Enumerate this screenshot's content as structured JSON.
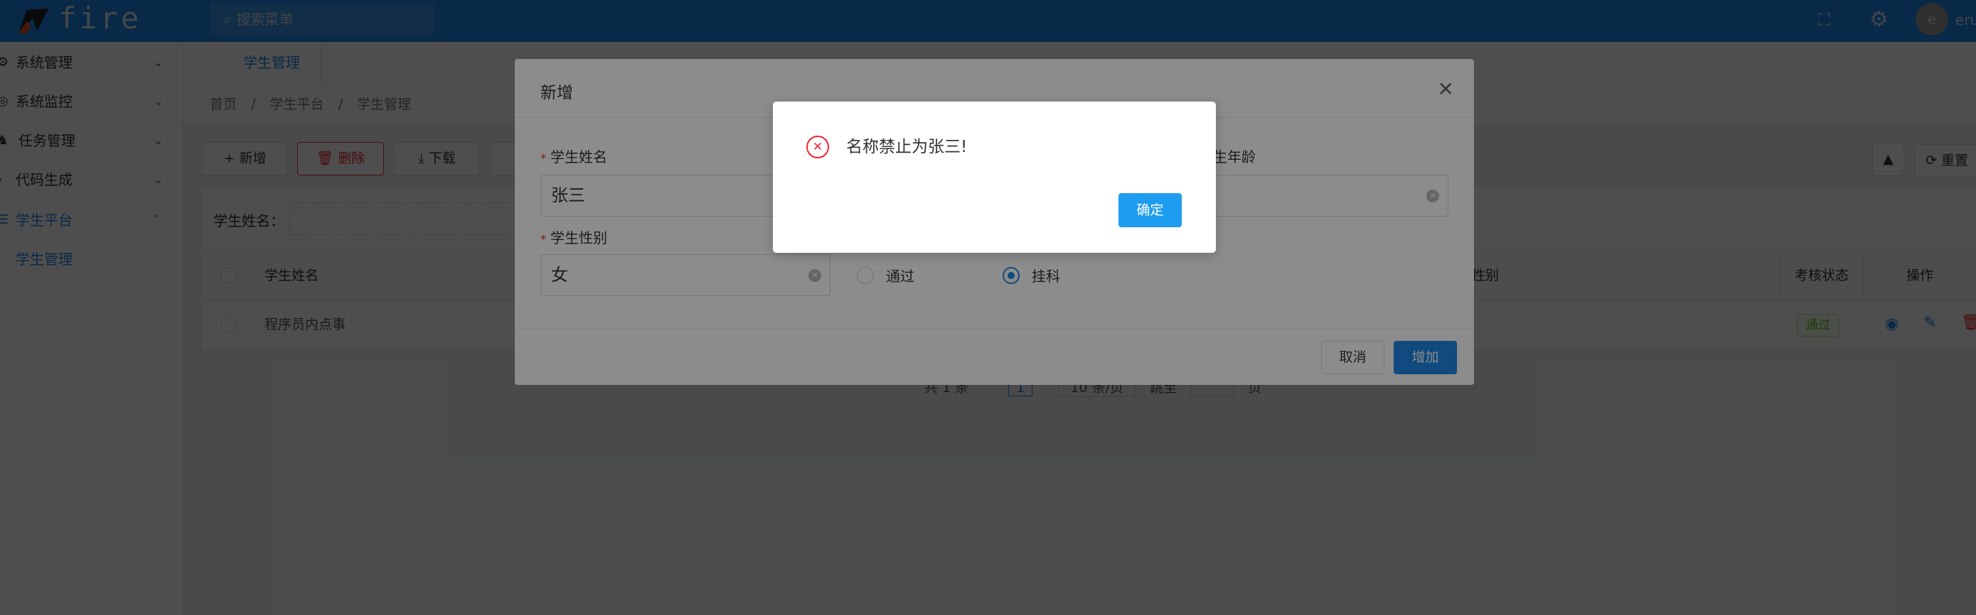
{
  "header": {
    "logo_text": "fire",
    "search_placeholder": "搜索菜单",
    "user_initial": "e",
    "username": "eru"
  },
  "sidebar": {
    "items": [
      {
        "label": "系统管理",
        "icon": "cluster-icon"
      },
      {
        "label": "系统监控",
        "icon": "monitor-icon"
      },
      {
        "label": "任务管理",
        "icon": "task-icon"
      },
      {
        "label": "代码生成",
        "icon": "code-icon"
      },
      {
        "label": "学生平台",
        "icon": "list-icon",
        "expanded": true
      },
      {
        "label": "学生管理",
        "sub": true,
        "active": true
      }
    ]
  },
  "tabs": [
    {
      "label": "学生管理"
    }
  ],
  "breadcrumb": [
    "首页",
    "学生平台",
    "学生管理"
  ],
  "breadcrumb_sep": "/",
  "toolbar": {
    "add": "新增",
    "delete": "删除",
    "download": "下载",
    "reset": "重置"
  },
  "search": {
    "name_label": "学生姓名："
  },
  "table": {
    "headers": {
      "name": "学生姓名",
      "gender": "性别",
      "status": "考核状态",
      "actions": "操作"
    },
    "rows": [
      {
        "name": "程序员内点事",
        "status": "通过"
      }
    ]
  },
  "pagination": {
    "total": "共 1 条",
    "page": "1",
    "page_size": "10 条/页",
    "goto": "跳至",
    "page_unit": "页"
  },
  "dialog": {
    "title": "新增",
    "name_label": "学生姓名",
    "name_value": "张三",
    "age_label": "学生年龄",
    "gender_label": "学生性别",
    "gender_value": "女",
    "status_options": [
      {
        "label": "通过",
        "checked": false
      },
      {
        "label": "挂科",
        "checked": true
      }
    ],
    "cancel": "取消",
    "submit": "增加"
  },
  "message": {
    "text": "名称禁止为张三!",
    "confirm": "确定",
    "type": "error"
  },
  "colors": {
    "primary": "#1e88e5",
    "danger": "#f5222d",
    "success": "#52c41a",
    "confirm_button": "#1e9cf0"
  }
}
